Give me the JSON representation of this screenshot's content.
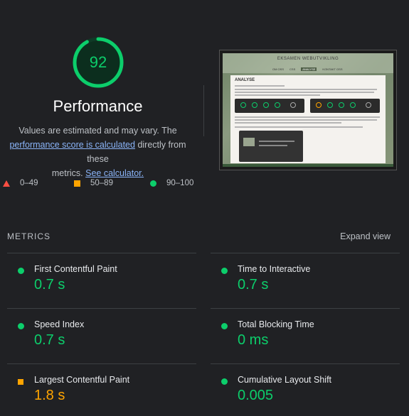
{
  "score": {
    "value": "92",
    "fraction": 0.92,
    "color": "#0cce6b"
  },
  "title": "Performance",
  "description": {
    "line1": "Values are estimated and may vary. The",
    "link1": "performance score is calculated",
    "mid": " directly from these",
    "tail": "metrics. ",
    "link2": "See calculator."
  },
  "legend": [
    {
      "label": "0–49",
      "icon": "fail-triangle-icon",
      "color": "#ff4e42"
    },
    {
      "label": "50–89",
      "icon": "average-square-icon",
      "color": "#ffa400"
    },
    {
      "label": "90–100",
      "icon": "pass-circle-icon",
      "color": "#0cce6b"
    }
  ],
  "screenshot": {
    "site_title": "EKSAMEN WEBUTVIKLING",
    "nav": [
      "OM OSS",
      "CSS",
      "ANALYSE",
      "KONTAKT OSS"
    ],
    "heading": "ANALYSE"
  },
  "metrics": {
    "header": "METRICS",
    "expand": "Expand view",
    "items": [
      {
        "name": "First Contentful Paint",
        "value": "0.7 s",
        "status": "pass"
      },
      {
        "name": "Time to Interactive",
        "value": "0.7 s",
        "status": "pass"
      },
      {
        "name": "Speed Index",
        "value": "0.7 s",
        "status": "pass"
      },
      {
        "name": "Total Blocking Time",
        "value": "0 ms",
        "status": "pass"
      },
      {
        "name": "Largest Contentful Paint",
        "value": "1.8 s",
        "status": "average"
      },
      {
        "name": "Cumulative Layout Shift",
        "value": "0.005",
        "status": "pass"
      }
    ]
  },
  "colors": {
    "pass": "#0cce6b",
    "average": "#ffa400",
    "fail": "#ff4e42",
    "link": "#8ab4f8"
  }
}
